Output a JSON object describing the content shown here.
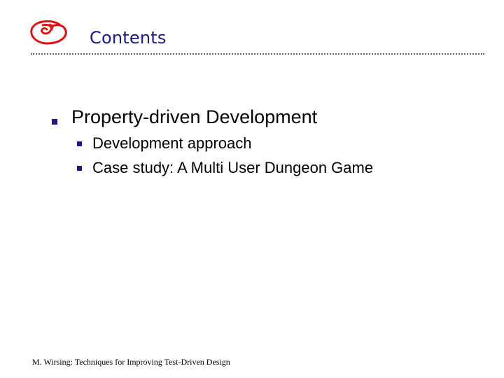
{
  "slide": {
    "logo_icon": "red-spiral-g-logo",
    "title": "Contents",
    "title_color": "#1a1a80",
    "bullet_color": "#1a1a80",
    "logo_color": "#e01010",
    "items": [
      {
        "label": "Property-driven Development",
        "subitems": [
          {
            "label": "Development approach"
          },
          {
            "label": "Case study: A Multi User Dungeon Game"
          }
        ]
      }
    ]
  },
  "footer": {
    "text": "M. Wirsing: Techniques for Improving Test-Driven Design"
  }
}
